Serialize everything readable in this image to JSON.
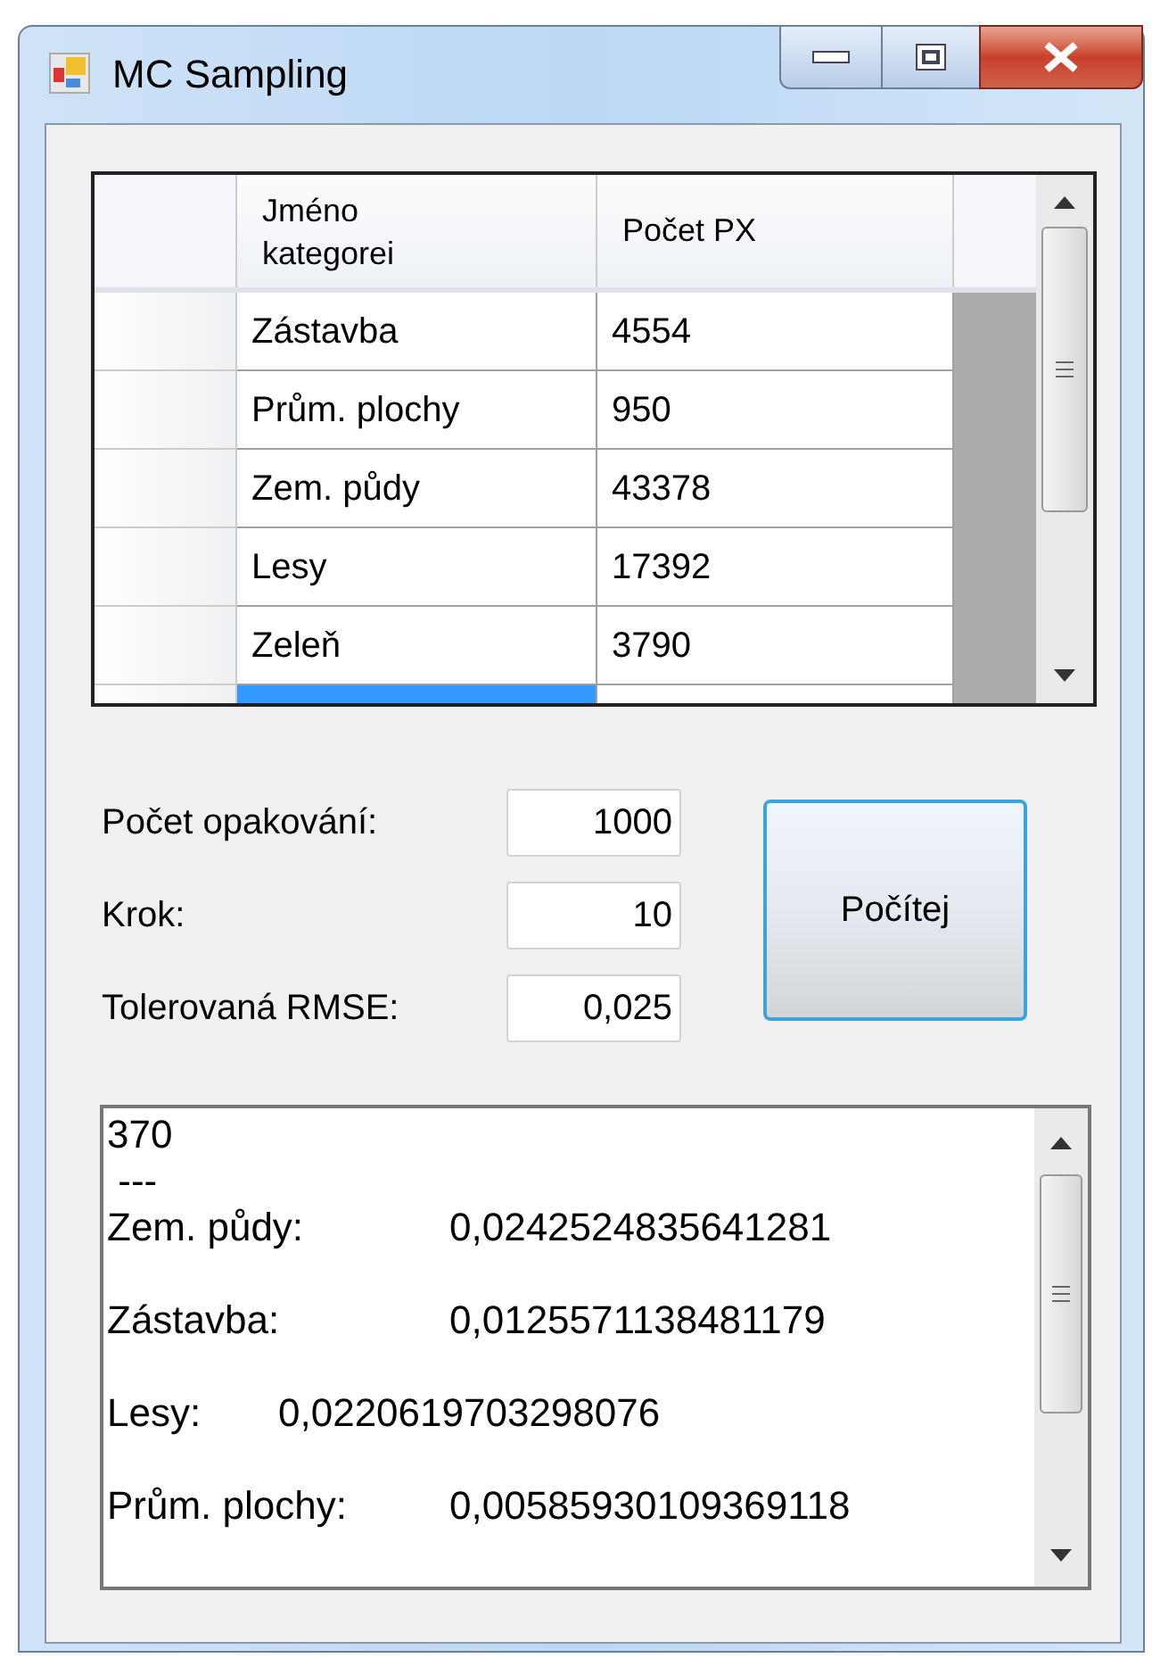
{
  "window": {
    "title": "MC Sampling"
  },
  "table": {
    "columns": [
      "Jméno kategorei",
      "Počet PX"
    ],
    "rows": [
      {
        "cells": [
          "Zástavba",
          "4554"
        ],
        "selected": false
      },
      {
        "cells": [
          "Prům. plochy",
          "950"
        ],
        "selected": false
      },
      {
        "cells": [
          "Zem. půdy",
          "43378"
        ],
        "selected": false
      },
      {
        "cells": [
          "Lesy",
          "17392"
        ],
        "selected": false
      },
      {
        "cells": [
          "Zeleň",
          "3790"
        ],
        "selected": false
      },
      {
        "cells": [],
        "selected": true
      }
    ]
  },
  "fields": [
    {
      "label": "Počet opakování:",
      "value": "1000"
    },
    {
      "label": "Krok:",
      "value": "10"
    },
    {
      "label": "Tolerovaná RMSE:",
      "value": "0,025"
    }
  ],
  "button": {
    "label": "Počítej"
  },
  "output": {
    "lines": [
      {
        "kind": "plain",
        "text": "370"
      },
      {
        "kind": "plain",
        "text": " ---"
      },
      {
        "kind": "result",
        "text": "Zem. půdy:\t0,0242524835641281"
      },
      {
        "kind": "result",
        "text": "Zástavba:\t0,0125571138481179"
      },
      {
        "kind": "result",
        "text": "Lesy:\t0,0220619703298076"
      },
      {
        "kind": "result",
        "text": "Prům. plochy:\t0,00585930109369118"
      }
    ]
  }
}
